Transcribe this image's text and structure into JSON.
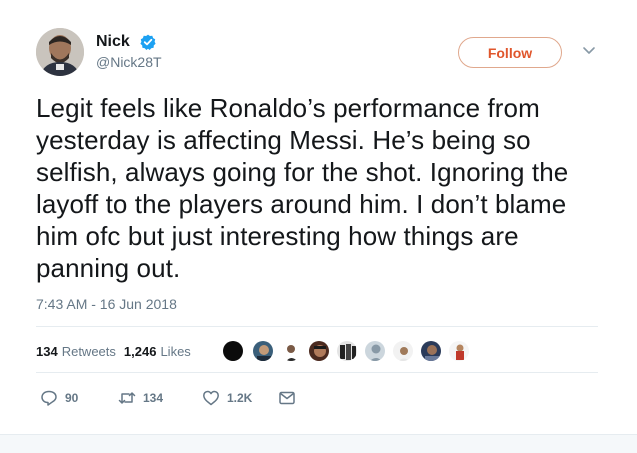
{
  "tweet": {
    "author_name": "Nick",
    "author_handle": "@Nick28T",
    "follow_label": "Follow",
    "text": "Legit feels like Ronaldo’s performance from yesterday is affecting Messi. He’s being so selfish, always going for the shot. Ignoring the layoff to the players around him. I don’t blame him ofc but just interesting how things are panning out.",
    "timestamp": "7:43 AM - 16 Jun 2018"
  },
  "stats": {
    "retweets_count": "134",
    "retweets_label": "Retweets",
    "likes_count": "1,246",
    "likes_label": "Likes"
  },
  "actions": {
    "reply_count": "90",
    "retweet_count": "134",
    "like_count": "1.2K"
  },
  "icons": {
    "verified": "verified-badge-icon",
    "caret": "chevron-down-icon",
    "reply": "reply-icon",
    "retweet": "retweet-icon",
    "like": "heart-icon",
    "message": "envelope-icon"
  },
  "colors": {
    "follow_accent": "#e0562c",
    "verified_blue": "#1da1f2",
    "text_secondary": "#657786"
  }
}
